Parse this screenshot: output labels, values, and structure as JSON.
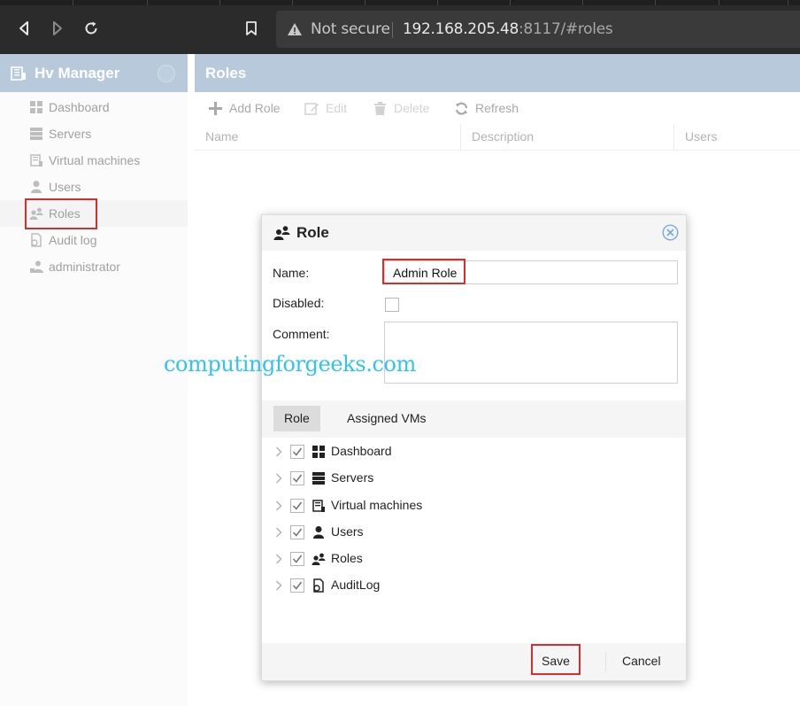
{
  "browser": {
    "back_icon": "back-arrow-icon",
    "forward_icon": "forward-arrow-icon",
    "reload_icon": "reload-icon",
    "bookmark_icon": "bookmark-icon",
    "security_label": "Not secure",
    "url_host": "192.168.205.48",
    "url_rest": ":8117/#roles"
  },
  "sidebar": {
    "title": "Hv Manager",
    "items": [
      {
        "label": "Dashboard",
        "icon": "dashboard-icon"
      },
      {
        "label": "Servers",
        "icon": "servers-icon"
      },
      {
        "label": "Virtual machines",
        "icon": "virtual-machines-icon"
      },
      {
        "label": "Users",
        "icon": "user-icon"
      },
      {
        "label": "Roles",
        "icon": "roles-icon",
        "active": true
      },
      {
        "label": "Audit log",
        "icon": "audit-log-icon"
      },
      {
        "label": "administrator",
        "icon": "administrator-icon"
      }
    ]
  },
  "main": {
    "title": "Roles",
    "toolbar": {
      "add": "Add Role",
      "edit": "Edit",
      "delete": "Delete",
      "refresh": "Refresh"
    },
    "columns": [
      "Name",
      "Description",
      "Users"
    ]
  },
  "watermark": "computingforgeeks.com",
  "dialog": {
    "title": "Role",
    "name_label": "Name:",
    "name_value": "Admin Role",
    "disabled_label": "Disabled:",
    "disabled_checked": false,
    "comment_label": "Comment:",
    "comment_value": "",
    "tabs": [
      "Role",
      "Assigned VMs"
    ],
    "active_tab": "Role",
    "permissions": [
      {
        "label": "Dashboard",
        "checked": true,
        "icon": "dashboard-icon"
      },
      {
        "label": "Servers",
        "checked": true,
        "icon": "servers-icon"
      },
      {
        "label": "Virtual machines",
        "checked": true,
        "icon": "virtual-machines-icon"
      },
      {
        "label": "Users",
        "checked": true,
        "icon": "user-icon"
      },
      {
        "label": "Roles",
        "checked": true,
        "icon": "roles-icon"
      },
      {
        "label": "AuditLog",
        "checked": true,
        "icon": "audit-log-icon"
      }
    ],
    "save_label": "Save",
    "cancel_label": "Cancel"
  },
  "colors": {
    "header_bg": "#b7c9da",
    "highlight": "#d32f2f",
    "watermark": "#2fc3f0"
  }
}
